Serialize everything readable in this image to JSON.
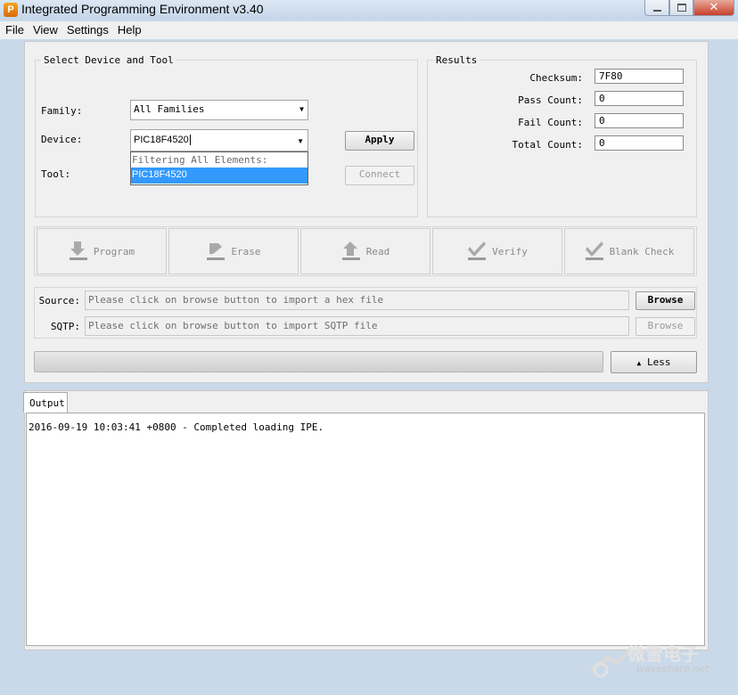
{
  "window": {
    "title": "Integrated Programming Environment v3.40",
    "app_icon_letter": "P"
  },
  "menu": [
    "File",
    "View",
    "Settings",
    "Help"
  ],
  "device_group": {
    "legend": "Select Device and Tool",
    "family_label": "Family:",
    "family_value": "All Families",
    "device_label": "Device:",
    "device_value": "PIC18F4520",
    "dropdown_header": "Filtering All Elements:",
    "dropdown_option": "PIC18F4520",
    "tool_label": "Tool:",
    "apply_label": "Apply",
    "connect_label": "Connect"
  },
  "results": {
    "legend": "Results",
    "checksum_label": "Checksum:",
    "checksum_value": "7F80",
    "pass_label": "Pass Count:",
    "pass_value": "0",
    "fail_label": "Fail Count:",
    "fail_value": "0",
    "total_label": "Total Count:",
    "total_value": "0"
  },
  "operations": {
    "program": "Program",
    "erase": "Erase",
    "read": "Read",
    "verify": "Verify",
    "blank_check": "Blank Check"
  },
  "source": {
    "label": "Source:",
    "placeholder": "Please click on browse button to import a hex file",
    "browse_label": "Browse"
  },
  "sqtp": {
    "label": "SQTP:",
    "placeholder": "Please click on browse button to import SQTP file",
    "browse_label": "Browse"
  },
  "less_button": "Less",
  "less_icon": "up-arrow",
  "output": {
    "tab_label": "Output",
    "log": "2016-09-19 10:03:41 +0800 - Completed loading IPE."
  },
  "watermark": {
    "cn": "微雪电子",
    "site": "waveshare.net"
  },
  "colors": {
    "selection": "#3399ff",
    "title_bar": "#c5d6e9",
    "close_button": "#c7402a"
  }
}
